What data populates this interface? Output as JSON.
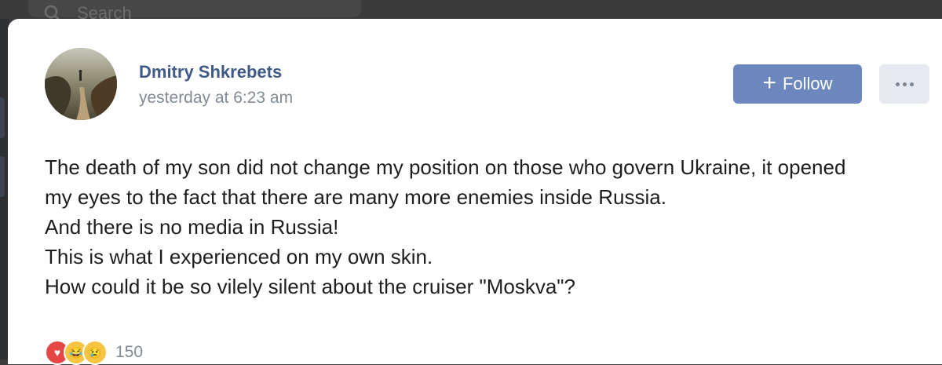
{
  "search": {
    "placeholder": "Search"
  },
  "post": {
    "author": "Dmitry Shkrebets",
    "time": "yesterday at 6:23 am",
    "follow_label": "Follow",
    "lines": [
      "The death of my son did not change my position on those who govern Ukraine, it opened",
      "my eyes to the fact that there are many more enemies inside Russia.",
      "And there is no media in Russia!",
      "This is what I experienced on my own skin.",
      "How could it be so vilely silent about the cruiser \"Moskva\"?"
    ]
  },
  "reactions": {
    "count": "150",
    "icons": [
      "heart-icon",
      "laughing-face-icon",
      "crying-face-icon"
    ]
  },
  "colors": {
    "accent": "#6c87bd",
    "author": "#3f5a86",
    "meta": "#828a94"
  }
}
